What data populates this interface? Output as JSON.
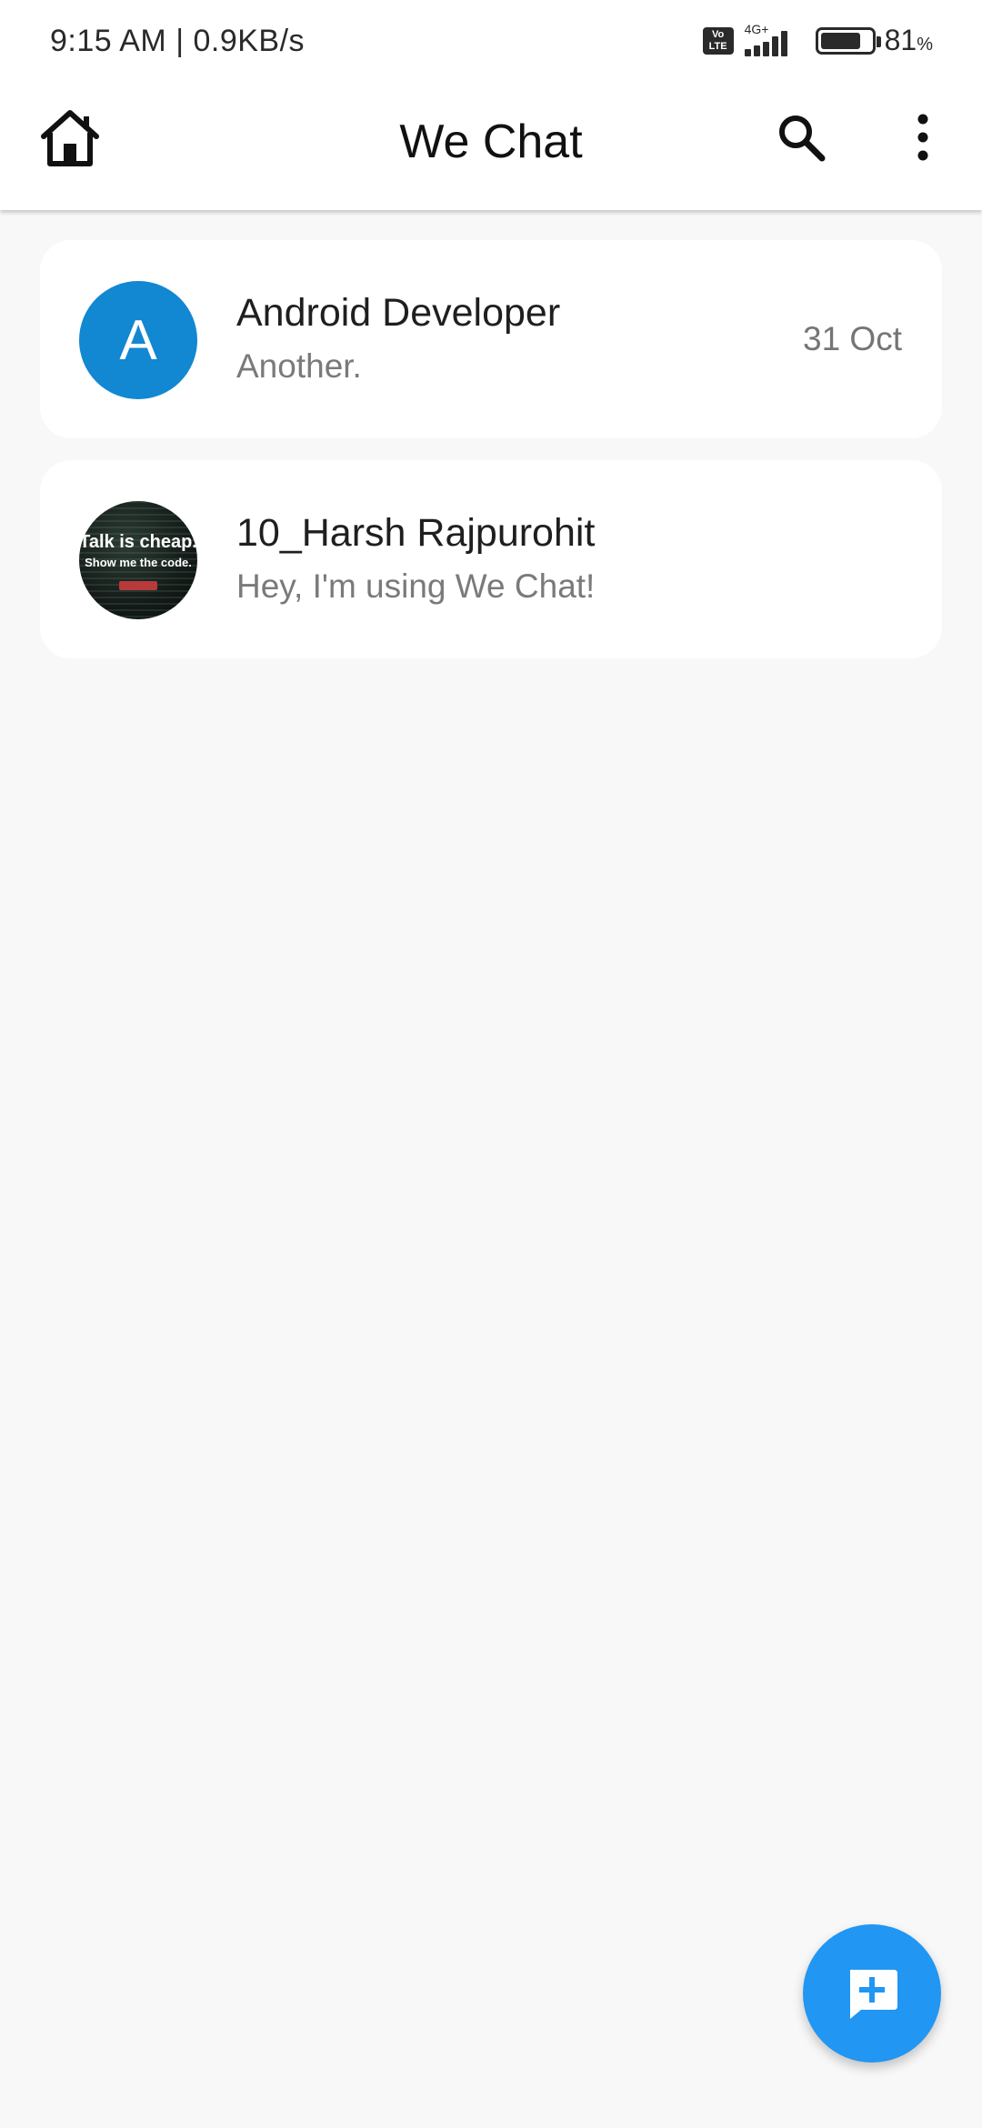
{
  "status_bar": {
    "time_speed": "9:15 AM | 0.9KB/s",
    "volte": "Vo LTE",
    "network": "4G+",
    "battery_level": 0.81,
    "battery_value": "81",
    "battery_unit": "%"
  },
  "app_bar": {
    "title": "We Chat",
    "icons": [
      "home-icon",
      "search-icon",
      "more-vert-icon"
    ]
  },
  "chats": [
    {
      "avatar_letter": "A",
      "name": "Android Developer",
      "preview": "Another.",
      "time": "31 Oct",
      "avatar_color": "#1287d2"
    },
    {
      "avatar_line1": "Talk is cheap.",
      "avatar_line2": "Show me the code.",
      "name": "10_Harsh Rajpurohit",
      "preview": "Hey, I'm using We Chat!",
      "time": ""
    }
  ],
  "fab": {
    "icon": "add-comment-icon",
    "color": "#2196f3"
  }
}
